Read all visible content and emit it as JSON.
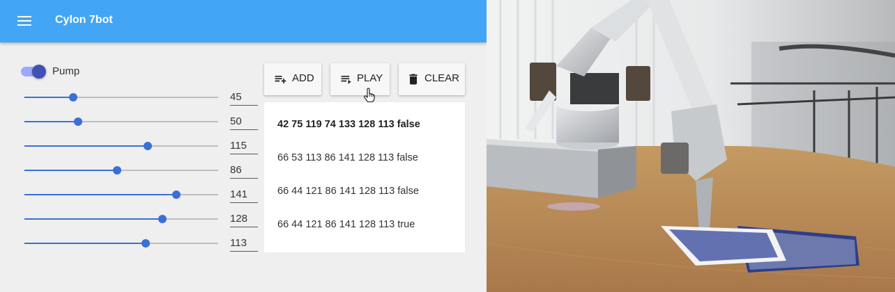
{
  "app": {
    "title": "Cylon 7bot"
  },
  "icons": {
    "menu": "menu-icon",
    "add": "playlist-add-icon",
    "play": "playlist-play-icon",
    "clear": "trash-icon",
    "cursor": "hand-pointer-icon"
  },
  "colors": {
    "appbar": "#42a5f5",
    "slider": "#3a6fd8",
    "toggle": "#3f51b5"
  },
  "pump": {
    "label": "Pump",
    "on": true
  },
  "sliders": [
    {
      "value": "45",
      "level": 0.25
    },
    {
      "value": "50",
      "level": 0.278
    },
    {
      "value": "115",
      "level": 0.638
    },
    {
      "value": "86",
      "level": 0.477
    },
    {
      "value": "141",
      "level": 0.783
    },
    {
      "value": "128",
      "level": 0.712
    },
    {
      "value": "113",
      "level": 0.627
    }
  ],
  "toolbar": {
    "add_label": "ADD",
    "play_label": "PLAY",
    "clear_label": "CLEAR"
  },
  "poses": [
    {
      "text": "42 75 119 74 133 128 113 false",
      "selected": true
    },
    {
      "text": "66 53 113 86 141 128 113 false",
      "selected": false
    },
    {
      "text": "66 44 121 86 141 128 113 false",
      "selected": false
    },
    {
      "text": "66 44 121 86 141 128 113 true",
      "selected": false
    }
  ]
}
